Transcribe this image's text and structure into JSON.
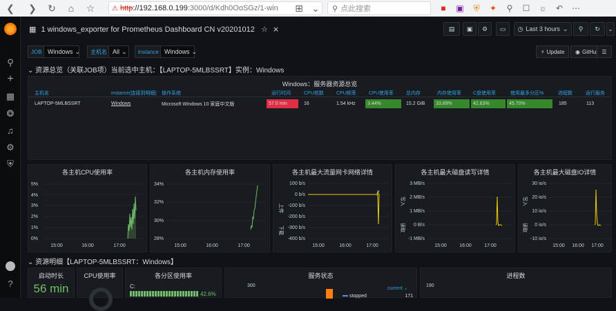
{
  "browser": {
    "url_security": "不安全",
    "url_protocol": "http",
    "url_host": "://192.168.0.199",
    "url_tail": ":3000/d/Kdh0OoSGz/1-win",
    "search_placeholder": "点此搜索"
  },
  "dashboard": {
    "title": "1 windows_exporter for Prometheus Dashboard CN v20201012",
    "time_range": "Last 3 hours"
  },
  "vars": [
    {
      "label": "JOB",
      "value": "Windows"
    },
    {
      "label": "主机名",
      "value": "All"
    },
    {
      "label": "instance",
      "value": "Windows"
    }
  ],
  "links": {
    "update": "Update",
    "github": "GitHub"
  },
  "row1": {
    "title": "资源总览（关联JOB项）当前选中主机：【LAPTOP-5MLBSSRT】实例：Windows"
  },
  "table": {
    "title": "Windows：服务器资源总览",
    "headers": [
      "主机名",
      "instance(连接到明细)",
      "操作系统",
      "运行时间",
      "CPU核数",
      "CPU频率",
      "CPU使用率",
      "总内存",
      "内存使用率",
      "C盘使用率",
      "使用最多分区%",
      "进程数",
      "运行服务"
    ],
    "row": [
      "LAPTOP-5MLBSSRT",
      "Windows",
      "Microsoft Windows 10 家庭中文版",
      "57.0 min",
      "16",
      "1.54 kHz",
      "3.44%",
      "15.2 GiB",
      "33.89%",
      "42.63%",
      "45.70%",
      "185",
      "113"
    ]
  },
  "colors": {
    "red": "#e02f44",
    "green": "#37872d",
    "line": "#73bf69",
    "yellow": "#f2cc0c",
    "blue": "#33a2e5"
  },
  "graphs": [
    {
      "title": "各主机CPU使用率",
      "y_ticks": [
        "5%",
        "4%",
        "3%",
        "2%",
        "1%",
        "0%"
      ],
      "x_ticks": [
        "15:00",
        "16:00",
        "17:00"
      ],
      "side_top": "",
      "side_bottom": ""
    },
    {
      "title": "各主机内存使用率",
      "y_ticks": [
        "34%",
        "32%",
        "30%",
        "28%"
      ],
      "x_ticks": [
        "15:00",
        "16:00",
        "17:00"
      ],
      "side_top": "",
      "side_bottom": ""
    },
    {
      "title": "各主机最大流量网卡网络详情",
      "y_ticks": [
        "100 b/s",
        "0 b/s",
        "-100 b/s",
        "-200 b/s",
        "-300 b/s",
        "-400 b/s"
      ],
      "x_ticks": [
        "15:00",
        "16:00",
        "17:00"
      ],
      "side_top": "上传",
      "side_bottom": "下载"
    },
    {
      "title": "各主机最大磁盘读写详情",
      "y_ticks": [
        "3 MB/s",
        "2 MB/s",
        "1 MB/s",
        "0 B/s",
        "-1 MB/s"
      ],
      "x_ticks": [
        "15:00",
        "16:00",
        "17:00"
      ],
      "side_top": "写入",
      "side_bottom": "读取"
    },
    {
      "title": "各主机最大磁盘IO详情",
      "y_ticks": [
        "30 io/s",
        "20 io/s",
        "10 io/s",
        "0 io/s",
        "-10 io/s"
      ],
      "x_ticks": [
        "15:00",
        "16:00",
        "17:00"
      ],
      "side_top": "写入",
      "side_bottom": "读取"
    }
  ],
  "row2": {
    "title": "资源明细【LAPTOP-5MLBSSRT：Windows】"
  },
  "bottom": {
    "uptime_title": "启动时长",
    "uptime_value": "56 min",
    "cpu_title": "CPU使用率",
    "disk_title": "各分区使用率",
    "disk_label": "C:",
    "disk_value": "42.6%",
    "services_title": "服务状态",
    "services_y": "300",
    "services_legend_hdr": "current",
    "services_legend_item": "stopped",
    "services_legend_val": "171",
    "proc_title": "进程数",
    "proc_y": "190"
  }
}
